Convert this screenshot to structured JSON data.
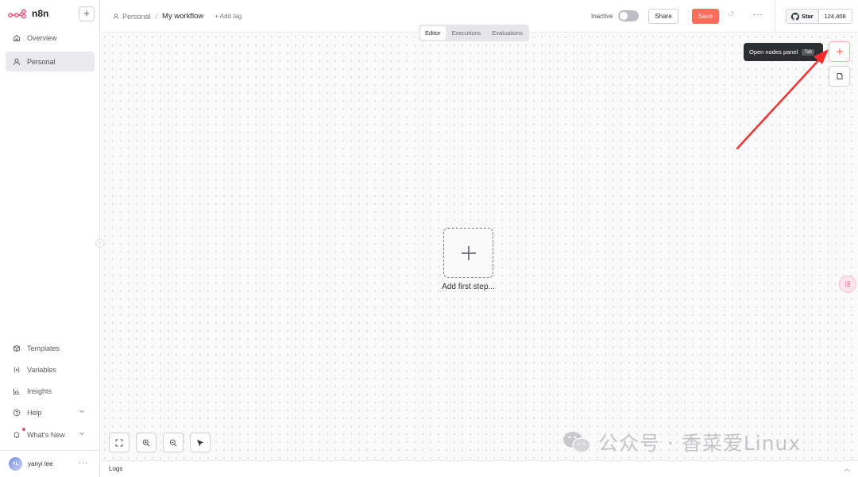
{
  "app": {
    "name": "n8n"
  },
  "sidebar": {
    "add_label": "+",
    "top_items": [
      {
        "label": "Overview",
        "icon": "home-icon"
      },
      {
        "label": "Personal",
        "icon": "user-icon",
        "active": true
      }
    ],
    "bottom_items": [
      {
        "label": "Templates",
        "icon": "box-icon"
      },
      {
        "label": "Variables",
        "icon": "variables-icon"
      },
      {
        "label": "Insights",
        "icon": "chart-icon"
      },
      {
        "label": "Help",
        "icon": "help-icon"
      },
      {
        "label": "What's New",
        "icon": "bell-icon"
      }
    ],
    "user": {
      "initials": "YL",
      "name": "yanyi lee",
      "more": "···"
    }
  },
  "header": {
    "breadcrumb_project": "Personal",
    "separator": "/",
    "workflow_name": "My workflow",
    "add_tag": "+ Add tag",
    "status_label": "Inactive",
    "share_label": "Share",
    "save_label": "Save",
    "more_label": "···",
    "github": {
      "star_label": "Star",
      "count": "124,408"
    }
  },
  "tabs": [
    {
      "label": "Editor",
      "active": true
    },
    {
      "label": "Executions"
    },
    {
      "label": "Evaluations"
    }
  ],
  "canvas": {
    "add_first_step": "Add first step...",
    "tooltip": {
      "text": "Open nodes panel",
      "key": "Tab"
    }
  },
  "watermark": {
    "text": "公众号 · 香菜爱Linux"
  },
  "logs": {
    "label": "Logs"
  },
  "colors": {
    "accent": "#ff6d5a",
    "brand": "#ea4b71",
    "arrow": "#ff2a2a"
  }
}
